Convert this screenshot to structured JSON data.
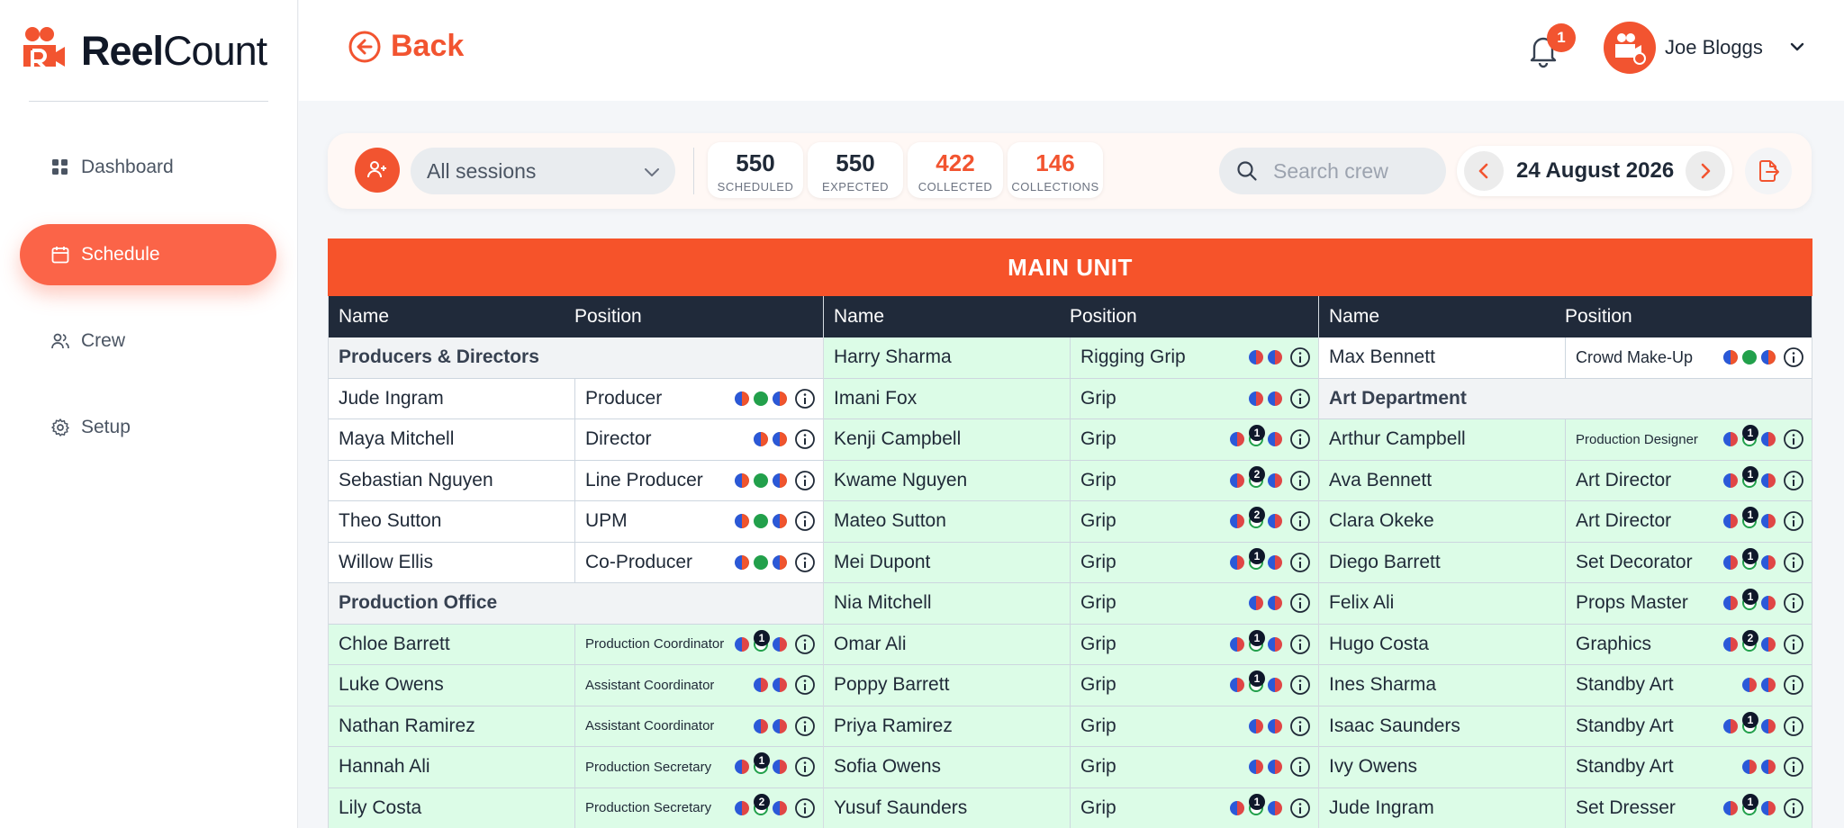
{
  "app": {
    "name_bold": "Reel",
    "name_light": "Count",
    "brand_color": "#f25430"
  },
  "nav": [
    {
      "label": "Dashboard",
      "icon": "grid-icon"
    },
    {
      "label": "Schedule",
      "icon": "calendar-icon",
      "active": true
    },
    {
      "label": "Crew",
      "icon": "users-icon"
    },
    {
      "label": "Setup",
      "icon": "gear-icon"
    }
  ],
  "header": {
    "back_label": "Back",
    "notification_count": "1",
    "user_name": "Joe Bloggs"
  },
  "toolbar": {
    "session_select": "All sessions",
    "stats": [
      {
        "value": "550",
        "label": "SCHEDULED"
      },
      {
        "value": "550",
        "label": "EXPECTED"
      },
      {
        "value": "422",
        "label": "COLLECTED"
      },
      {
        "value": "146",
        "label": "COLLECTIONS"
      }
    ],
    "search_placeholder": "Search crew",
    "date": "24 August 2026"
  },
  "table": {
    "unit_title": "MAIN UNIT",
    "name_header": "Name",
    "position_header": "Position",
    "columns": [
      [
        {
          "group": "Producers & Directors"
        },
        {
          "name": "Jude Ingram",
          "position": "Producer",
          "status": "white",
          "dots": [
            "bo",
            "gr",
            "bo"
          ]
        },
        {
          "name": "Maya Mitchell",
          "position": "Director",
          "status": "white",
          "dots": [
            "bo",
            "bo"
          ]
        },
        {
          "name": "Sebastian Nguyen",
          "position": "Line Producer",
          "status": "white",
          "dots": [
            "bo",
            "gr",
            "bo"
          ]
        },
        {
          "name": "Theo Sutton",
          "position": "UPM",
          "status": "white",
          "dots": [
            "bo",
            "gr",
            "bo"
          ]
        },
        {
          "name": "Willow Ellis",
          "position": "Co-Producer",
          "status": "white",
          "dots": [
            "bo",
            "gr",
            "bo"
          ]
        },
        {
          "group": "Production Office"
        },
        {
          "name": "Chloe Barrett",
          "position": "Production Coordinator",
          "status": "green",
          "size": "small",
          "dots": [
            "br",
            "gb",
            "br"
          ],
          "count": "1"
        },
        {
          "name": "Luke Owens",
          "position": "Assistant Coordinator",
          "status": "green",
          "size": "small1",
          "dots": [
            "br",
            "br"
          ]
        },
        {
          "name": "Nathan Ramirez",
          "position": "Assistant Coordinator",
          "status": "green",
          "size": "small1",
          "dots": [
            "br",
            "br"
          ]
        },
        {
          "name": "Hannah Ali",
          "position": "Production Secretary",
          "status": "green",
          "size": "small",
          "dots": [
            "br",
            "gb",
            "br"
          ],
          "count": "1"
        },
        {
          "name": "Lily Costa",
          "position": "Production Secretary",
          "status": "green",
          "size": "small",
          "dots": [
            "br",
            "gb",
            "br"
          ],
          "count": "2"
        }
      ],
      [
        {
          "name": "Harry Sharma",
          "position": "Rigging Grip",
          "status": "green",
          "dots": [
            "br",
            "br"
          ]
        },
        {
          "name": "Imani Fox",
          "position": "Grip",
          "status": "green",
          "dots": [
            "br",
            "br"
          ]
        },
        {
          "name": "Kenji Campbell",
          "position": "Grip",
          "status": "green",
          "dots": [
            "br",
            "gb",
            "br"
          ],
          "count": "1"
        },
        {
          "name": "Kwame Nguyen",
          "position": "Grip",
          "status": "green",
          "dots": [
            "br",
            "gb",
            "br"
          ],
          "count": "2"
        },
        {
          "name": "Mateo Sutton",
          "position": "Grip",
          "status": "green",
          "dots": [
            "br",
            "gb",
            "br"
          ],
          "count": "2"
        },
        {
          "name": "Mei Dupont",
          "position": "Grip",
          "status": "green",
          "dots": [
            "br",
            "gb",
            "br"
          ],
          "count": "1"
        },
        {
          "name": "Nia Mitchell",
          "position": "Grip",
          "status": "green",
          "dots": [
            "br",
            "br"
          ]
        },
        {
          "name": "Omar Ali",
          "position": "Grip",
          "status": "green",
          "dots": [
            "br",
            "gb",
            "br"
          ],
          "count": "1"
        },
        {
          "name": "Poppy Barrett",
          "position": "Grip",
          "status": "green",
          "dots": [
            "br",
            "gb",
            "br"
          ],
          "count": "1"
        },
        {
          "name": "Priya Ramirez",
          "position": "Grip",
          "status": "green",
          "dots": [
            "br",
            "br"
          ]
        },
        {
          "name": "Sofia Owens",
          "position": "Grip",
          "status": "green",
          "dots": [
            "br",
            "br"
          ]
        },
        {
          "name": "Yusuf Saunders",
          "position": "Grip",
          "status": "green",
          "dots": [
            "br",
            "gb",
            "br"
          ],
          "count": "1"
        }
      ],
      [
        {
          "name": "Max Bennett",
          "position": "Crowd Make-Up",
          "status": "white",
          "size": "mid",
          "dots": [
            "bo",
            "gr",
            "bo"
          ]
        },
        {
          "group": "Art Department"
        },
        {
          "name": "Arthur Campbell",
          "position": "Production Designer",
          "status": "green",
          "size": "small",
          "dots": [
            "br",
            "gb",
            "br"
          ],
          "count": "1"
        },
        {
          "name": "Ava Bennett",
          "position": "Art Director",
          "status": "green",
          "dots": [
            "br",
            "gb",
            "br"
          ],
          "count": "1"
        },
        {
          "name": "Clara Okeke",
          "position": "Art Director",
          "status": "green",
          "dots": [
            "br",
            "gb",
            "br"
          ],
          "count": "1"
        },
        {
          "name": "Diego Barrett",
          "position": "Set Decorator",
          "status": "green",
          "dots": [
            "br",
            "gb",
            "br"
          ],
          "count": "1"
        },
        {
          "name": "Felix Ali",
          "position": "Props Master",
          "status": "green",
          "dots": [
            "br",
            "gb",
            "br"
          ],
          "count": "1"
        },
        {
          "name": "Hugo Costa",
          "position": "Graphics",
          "status": "green",
          "dots": [
            "br",
            "gb",
            "br"
          ],
          "count": "2"
        },
        {
          "name": "Ines Sharma",
          "position": "Standby Art",
          "status": "green",
          "dots": [
            "br",
            "br"
          ]
        },
        {
          "name": "Isaac Saunders",
          "position": "Standby Art",
          "status": "green",
          "dots": [
            "br",
            "gb",
            "br"
          ],
          "count": "1"
        },
        {
          "name": "Ivy Owens",
          "position": "Standby Art",
          "status": "green",
          "dots": [
            "br",
            "br"
          ]
        },
        {
          "name": "Jude Ingram",
          "position": "Set Dresser",
          "status": "green",
          "dots": [
            "br",
            "gb",
            "br"
          ],
          "count": "1"
        }
      ]
    ]
  }
}
